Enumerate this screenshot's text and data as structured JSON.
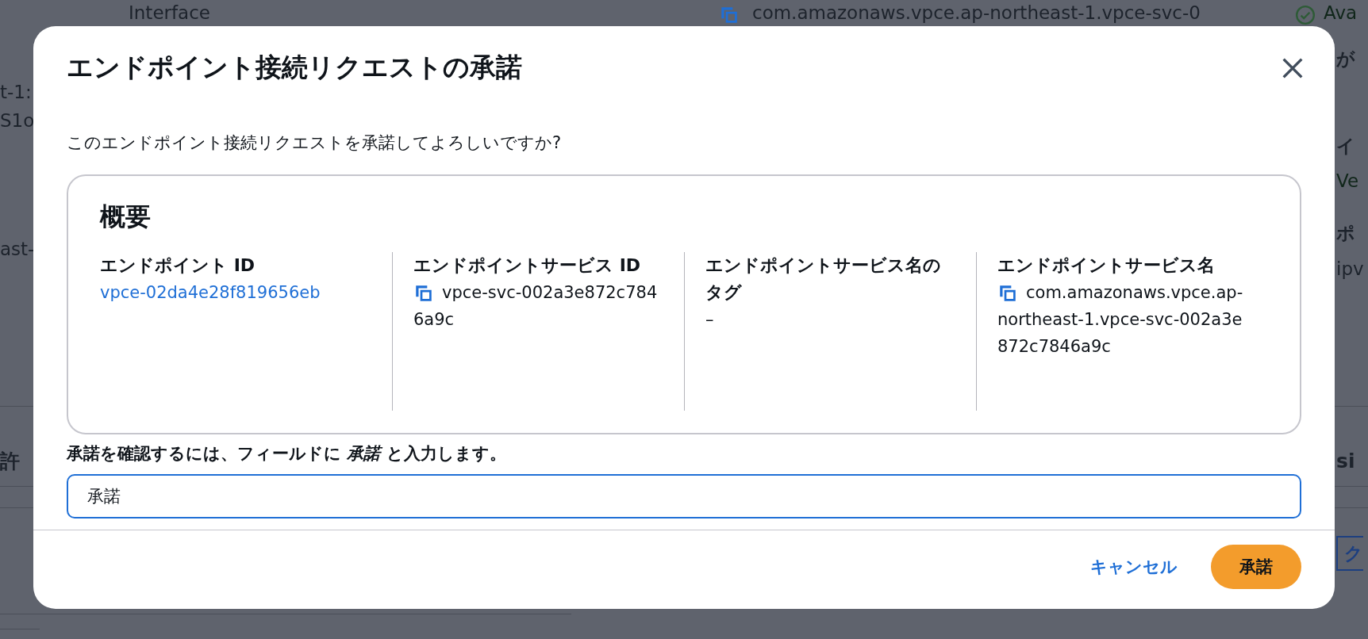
{
  "background_page": {
    "fragments": [
      {
        "text": "Interface",
        "kind": "text"
      },
      {
        "text": "com.amazonaws.vpce.ap-northeast-1.vpce-svc-0",
        "kind": "copyable"
      },
      {
        "text": "Ava",
        "kind": "status"
      },
      {
        "text": "t-1:",
        "kind": "text"
      },
      {
        "text": "S1o",
        "kind": "text"
      },
      {
        "text": "ast-",
        "kind": "text"
      },
      {
        "text": "許",
        "kind": "heading"
      },
      {
        "text": "が",
        "kind": "label"
      },
      {
        "text": "イ",
        "kind": "label"
      },
      {
        "text": "Ve",
        "kind": "status"
      },
      {
        "text": "ポ",
        "kind": "label"
      },
      {
        "text": "ipv",
        "kind": "text"
      },
      {
        "text": "si",
        "kind": "heading"
      },
      {
        "text": "ク",
        "kind": "button"
      }
    ]
  },
  "dialog": {
    "title": "エンドポイント接続リクエストの承諾",
    "question": "このエンドポイント接続リクエストを承諾してよろしいですか?",
    "summary": {
      "heading": "概要",
      "fields": [
        {
          "label": "エンドポイント ID",
          "value": "vpce-02da4e28f819656eb",
          "kind": "link"
        },
        {
          "label": "エンドポイントサービス ID",
          "value": "vpce-svc-002a3e872c7846a9c",
          "kind": "copyable"
        },
        {
          "label": "エンドポイントサービス名のタグ",
          "value": "–",
          "kind": "text"
        },
        {
          "label": "エンドポイントサービス名",
          "value": "com.amazonaws.vpce.ap-northeast-1.vpce-svc-002a3e872c7846a9c",
          "kind": "copyable"
        }
      ]
    },
    "confirm_label": "承諾を確認するには、フィールドに *承諾* と入力します。",
    "confirm_input": {
      "value": "承諾",
      "focused": true
    },
    "buttons": [
      {
        "label": "キャンセル",
        "kind": "link"
      },
      {
        "label": "承諾",
        "kind": "primary"
      }
    ]
  }
}
